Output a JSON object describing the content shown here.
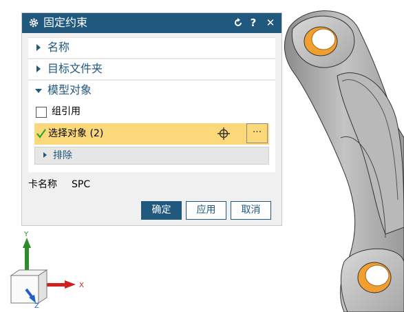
{
  "dialog": {
    "title": "固定约束",
    "buttons": {
      "reset_icon": "reset-icon",
      "help": "?",
      "close": "✕"
    },
    "sections": {
      "name": {
        "label": "名称",
        "state": "collapsed"
      },
      "target_folder": {
        "label": "目标文件夹",
        "state": "collapsed"
      },
      "model_objects": {
        "label": "模型对象",
        "state": "expanded",
        "group_reference": {
          "label": "组引用",
          "checked": false
        },
        "select_objects": {
          "label": "选择对象 (2)",
          "more": "···"
        },
        "exclude": {
          "label": "排除"
        }
      }
    },
    "card": {
      "label": "卡名称",
      "value": "SPC"
    },
    "actions": {
      "ok": "确定",
      "apply": "应用",
      "cancel": "取消"
    }
  },
  "triad": {
    "x": "X",
    "y": "Y",
    "z": "Z"
  },
  "colors": {
    "titlebar": "#20587e",
    "selection": "#fbd97a",
    "check": "#2fa12f",
    "y_axis": "#2e8b2e",
    "x_axis": "#d02020",
    "z_axis": "#1f5fc8",
    "hole": "#f0a030"
  }
}
